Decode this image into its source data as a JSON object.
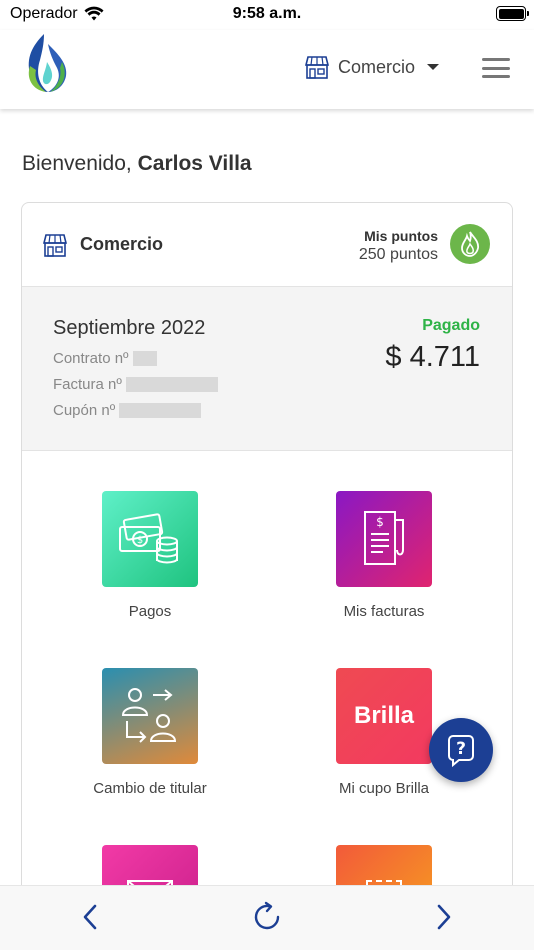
{
  "status_bar": {
    "carrier": "Operador",
    "time": "9:58 a.m."
  },
  "header": {
    "selector_label": "Comercio",
    "icons": [
      "logo-flame",
      "store-icon",
      "caret-down",
      "menu-icon"
    ]
  },
  "welcome": {
    "greeting": "Bienvenido,",
    "user_name": "Carlos Villa"
  },
  "card": {
    "account_type": "Comercio",
    "points_title": "Mis puntos",
    "points_value": "250 puntos",
    "bill": {
      "month": "Septiembre 2022",
      "contract_label": "Contrato nº",
      "invoice_label": "Factura nº",
      "coupon_label": "Cupón nº",
      "status": "Pagado",
      "amount": "$ 4.711"
    },
    "tiles": [
      {
        "label": "Pagos",
        "icon": "money-icon"
      },
      {
        "label": "Mis facturas",
        "icon": "invoice-icon"
      },
      {
        "label": "Cambio de titular",
        "icon": "transfer-icon"
      },
      {
        "label": "Mi cupo Brilla",
        "icon": "brilla-logo",
        "logo_text": "Brilla"
      },
      {
        "label": "",
        "icon": "envelope-icon"
      },
      {
        "label": "",
        "icon": "receipt-icon",
        "logo_text": "-$-"
      }
    ]
  },
  "colors": {
    "accent_blue": "#1c3f94",
    "paid_green": "#2eb347",
    "points_green": "#6cb64a",
    "pagos_gradient": [
      "#5ff0c8",
      "#1fc37f"
    ],
    "facturas_gradient": [
      "#8a18c4",
      "#e0246f"
    ],
    "titular_gradient": [
      "#2a8fb0",
      "#e08a3a"
    ],
    "brilla_gradient": [
      "#ef4a52",
      "#f33a60"
    ]
  },
  "bottom_nav": {
    "icons": [
      "back-icon",
      "refresh-icon",
      "forward-icon"
    ]
  }
}
